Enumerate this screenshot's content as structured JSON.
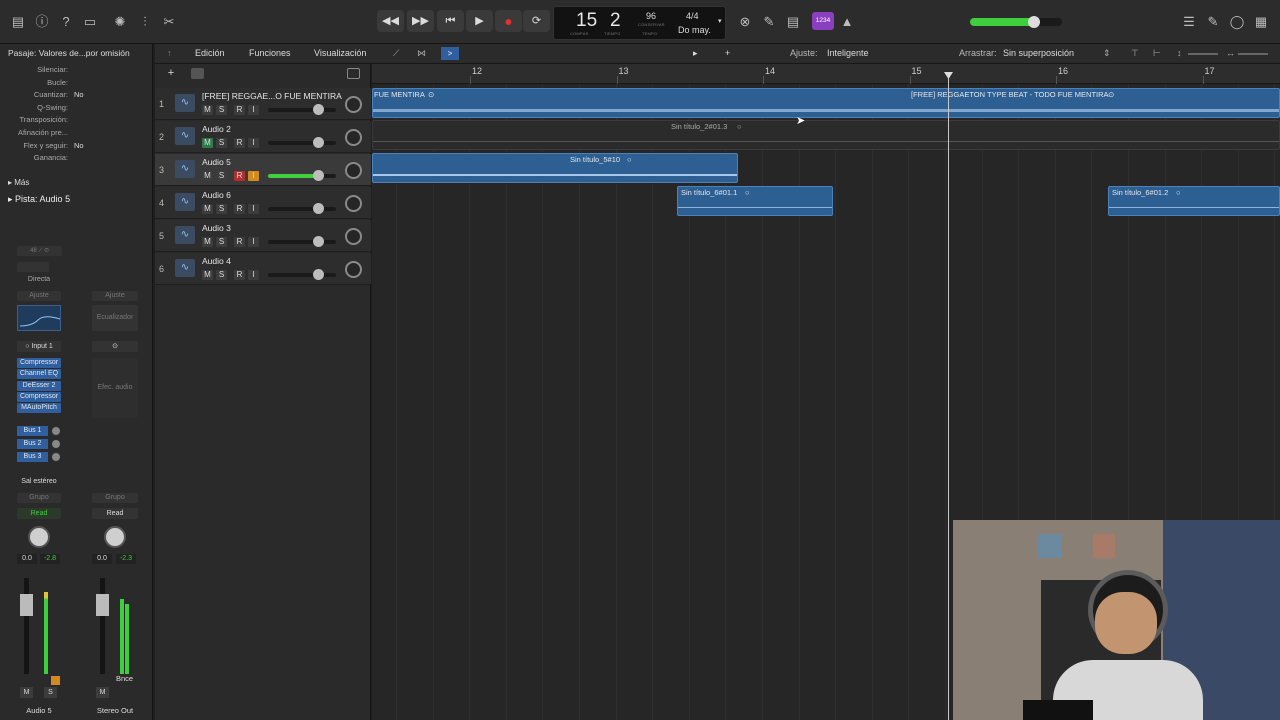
{
  "lcd": {
    "bar": "15",
    "beat": "2",
    "label_bar": "COMPÁS",
    "label_beat": "TIEMPO",
    "tempo": "96",
    "tempo_label": "CONSERVAR",
    "tempo_sub": "TEMPO",
    "signature": "4/4",
    "key": "Do may."
  },
  "toolbar": {
    "count_in": "1234"
  },
  "inspector": {
    "header": "Pasaje: Valores de...por omisión",
    "rows": [
      {
        "k": "Silenciar:",
        "v": ""
      },
      {
        "k": "Bucle:",
        "v": ""
      },
      {
        "k": "Cuantizar:",
        "v": "No"
      },
      {
        "k": "Q-Swing:",
        "v": ""
      },
      {
        "k": "Transposición:",
        "v": ""
      },
      {
        "k": "Afinación pre...",
        "v": ""
      },
      {
        "k": "Flex y seguir:",
        "v": "No"
      },
      {
        "k": "Ganancia:",
        "v": ""
      }
    ],
    "more": "Más",
    "track_header": "Pista: Audio 5",
    "strip1": {
      "mode": "Directa",
      "eq": "Ajuste",
      "input": "Input 1",
      "plugins": [
        "Compressor",
        "Channel EQ",
        "DeEsser 2",
        "Compressor",
        "MAutoPitch"
      ],
      "buses": [
        "Bus 1",
        "Bus 2",
        "Bus 3"
      ],
      "output": "Sal estéreo",
      "group": "Grupo",
      "auto": "Read",
      "vol": "0.0",
      "peak": "-2.8",
      "m": "M",
      "s": "S",
      "name": "Audio 5"
    },
    "strip2": {
      "eq": "Ajuste",
      "eq_label": "Ecualizador",
      "fx_label": "Efec. audio",
      "group": "Grupo",
      "auto": "Read",
      "vol": "0.0",
      "peak": "-2.3",
      "bnce": "Bnce",
      "m": "M",
      "name": "Stereo Out"
    }
  },
  "menus": {
    "edicion": "Edición",
    "funciones": "Funciones",
    "visualizacion": "Visualización",
    "ajuste_label": "Ajuste:",
    "ajuste_value": "Inteligente",
    "arrastrar_label": "Arrastrar:",
    "arrastrar_value": "Sin superposición"
  },
  "ruler": [
    "12",
    "13",
    "14",
    "15",
    "16",
    "17"
  ],
  "tracks": [
    {
      "num": "1",
      "name": "[FREE] REGGAE...O FUE MENTIRA"
    },
    {
      "num": "2",
      "name": "Audio 2"
    },
    {
      "num": "3",
      "name": "Audio 5"
    },
    {
      "num": "4",
      "name": "Audio 6"
    },
    {
      "num": "5",
      "name": "Audio 3"
    },
    {
      "num": "6",
      "name": "Audio 4"
    }
  ],
  "regions": {
    "r1a": "FUE MENTIRA",
    "r1b": "[FREE] REGGAETON TYPE BEAT - TODO FUE MENTIRA",
    "r2": "Sin título_2#01.3",
    "r3": "Sin título_5#10",
    "r4a": "Sin título_6#01.1",
    "r4b": "Sin título_6#01.2"
  },
  "buttons": {
    "m": "M",
    "s": "S",
    "r": "R",
    "i": "I"
  },
  "colors": {
    "region": "#2d5f93",
    "accent_green": "#3ecf3e",
    "record": "#e03030"
  }
}
